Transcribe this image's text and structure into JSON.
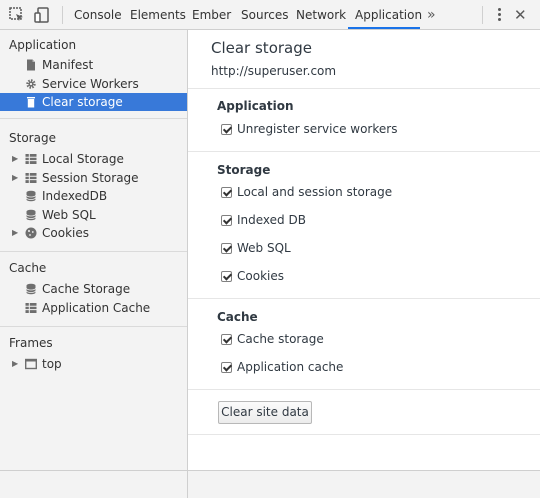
{
  "toolbar": {
    "tabs": [
      "Console",
      "Elements",
      "Ember",
      "Sources",
      "Network",
      "Application"
    ],
    "active_tab": "Application",
    "more_tabs_glyph": "»",
    "close_glyph": "✕",
    "accent": "#1a73e8"
  },
  "sidebar": {
    "sections": {
      "application": "Application",
      "storage": "Storage",
      "cache": "Cache",
      "frames": "Frames"
    },
    "items": {
      "manifest": "Manifest",
      "service_workers": "Service Workers",
      "clear_storage": "Clear storage",
      "local_storage": "Local Storage",
      "session_storage": "Session Storage",
      "indexeddb": "IndexedDB",
      "web_sql": "Web SQL",
      "cookies": "Cookies",
      "cache_storage": "Cache Storage",
      "application_cache": "Application Cache",
      "top": "top"
    },
    "selected": "Clear storage",
    "selected_color": "#3879d9"
  },
  "main": {
    "title": "Clear storage",
    "origin": "http://superuser.com",
    "groups": {
      "application": {
        "title": "Application",
        "options": [
          "Unregister service workers"
        ]
      },
      "storage": {
        "title": "Storage",
        "options": [
          "Local and session storage",
          "Indexed DB",
          "Web SQL",
          "Cookies"
        ]
      },
      "cache": {
        "title": "Cache",
        "options": [
          "Cache storage",
          "Application cache"
        ]
      }
    },
    "clear_button": "Clear site data"
  }
}
